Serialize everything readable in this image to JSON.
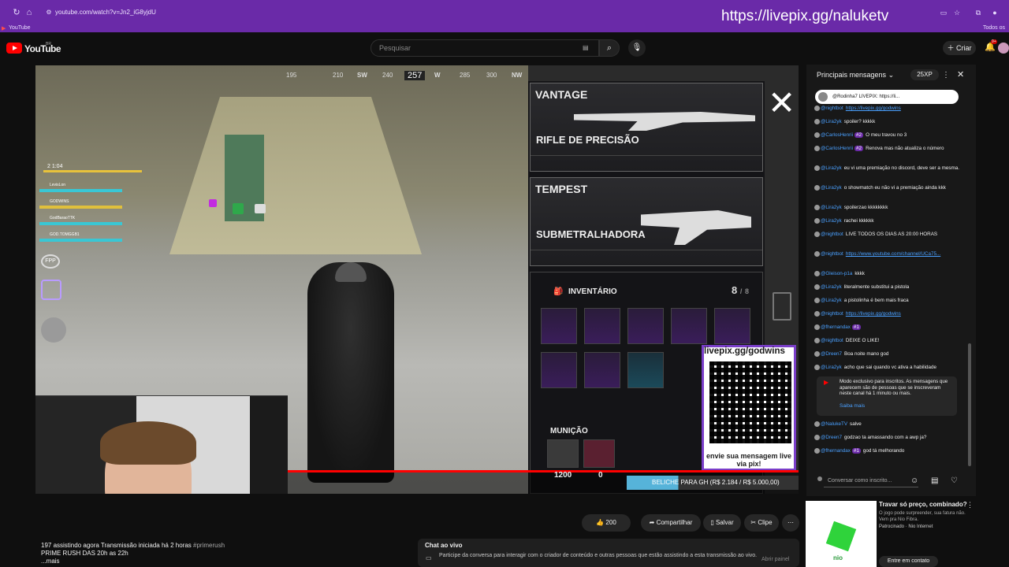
{
  "browser": {
    "url": "youtube.com/watch?v=Jn2_iG8yjdU",
    "bookmark_first": "YouTube",
    "bookmark_right": "Todos os",
    "overlay_banner": "https://livepix.gg/naluketv"
  },
  "header": {
    "logo_text": "YouTube",
    "region": "BR",
    "search_placeholder": "Pesquisar",
    "create_label": "Criar",
    "notification_count": "9+"
  },
  "video": {
    "compass": {
      "ticks": [
        "195",
        "210",
        "SW",
        "240",
        "257",
        "W",
        "285",
        "300",
        "NW"
      ],
      "current": "257"
    },
    "hud": {
      "round_info": "2 1:04",
      "team": [
        {
          "name": "LevisLon"
        },
        {
          "name": "GODWINS"
        },
        {
          "name": "GodBaraoTTK"
        },
        {
          "name": "GOD.TOMGGB1"
        }
      ],
      "fpp_label": "FPP"
    },
    "weapons": [
      {
        "name": "VANTAGE",
        "type": "RIFLE DE PRECISÃO"
      },
      {
        "name": "TEMPEST",
        "type": "SUBMETRALHADORA"
      }
    ],
    "inventory": {
      "title": "INVENTÁRIO",
      "count": "8",
      "capacity": "8",
      "ammo_title": "MUNIÇÃO"
    },
    "qr": {
      "label": "livepix.gg/godwins",
      "cta": "envie sua mensagem live via pix!"
    },
    "score": {
      "left": "1200",
      "right": "0"
    },
    "ticker_text": "BELICHE PARA GH (R$ 2.184 / R$ 5.000,00)"
  },
  "actions": {
    "likes": "200",
    "share": "Compartilhar",
    "save": "Salvar",
    "clip": "Clipe"
  },
  "description": {
    "line1": "197 assistindo agora  Transmissão iniciada há 2 horas",
    "hashtag": "#primerush",
    "line2": "PRIME RUSH DAS 20h as 22h",
    "more": "...mais"
  },
  "live_chat_box": {
    "title": "Chat ao vivo",
    "description": "Participe da conversa para interagir com o criador de conteúdo e outras pessoas que estão assistindo a esta transmissão ao vivo.",
    "open_button": "Abrir painel"
  },
  "chat": {
    "header": "Principais mensagens",
    "xp_badge": "25XP",
    "pinned": "@Rodinha7  LIVEPIX: https://li...",
    "messages": [
      {
        "user": "@nightbot",
        "text": "https://livepix.gg/godwins",
        "link": true
      },
      {
        "user": "@Lira2yk",
        "text": "spoiler? kkkkk"
      },
      {
        "user": "@CarlosHenrii",
        "badge": "#2",
        "text": "O meu travou no 3"
      },
      {
        "user": "@CarlosHenrii",
        "badge": "#2",
        "text": "Renova mas não atualiza o número"
      },
      {
        "user": "@Lira2yk",
        "text": "eu vi uma premiação no discord, deve ser a mesma."
      },
      {
        "user": "@Lira2yk",
        "text": "o showmatch eu não vi a premiação ainda kkk"
      },
      {
        "user": "@Lira2yk",
        "text": "spoilerzao kkkkkkkk"
      },
      {
        "user": "@Lira2yk",
        "text": "rachei kkkkkk"
      },
      {
        "user": "@nightbot",
        "text": "LIVE TODOS OS DIAS AS 20:00 HORAS"
      },
      {
        "user": "@nightbot",
        "text": "https://www.youtube.com/channel/UCa75...",
        "link": true
      },
      {
        "user": "@Gleison-p1a",
        "text": "kkkk"
      },
      {
        "user": "@Lira2yk",
        "text": "literalmente substitui a pistola"
      },
      {
        "user": "@Lira2yk",
        "text": "a pistolinha é bem mais fraca"
      },
      {
        "user": "@nightbot",
        "text": "https://livepix.gg/godwins",
        "link": true
      },
      {
        "user": "@fhernandax",
        "badge": "#1",
        "text": ""
      },
      {
        "user": "@nightbot",
        "text": "DEIXE O LIKE!"
      },
      {
        "user": "@Dreen7",
        "text": "Boa noite mano god"
      },
      {
        "user": "@Lira2yk",
        "text": "acho que sai quando vc ativa a habilidade"
      }
    ],
    "members_notice": "Modo exclusivo para inscritos. As mensagens que aparecem são de pessoas que se inscreveram neste canal há 1 minuto ou mais.",
    "members_link": "Saiba mais",
    "after_messages": [
      {
        "user": "@NalukeTV",
        "text": "salve"
      },
      {
        "user": "@Dreen7",
        "text": "godzao ta amassando com a awp ja?"
      },
      {
        "user": "@fhernandax",
        "badge": "#1",
        "text": "god tá melhorando"
      }
    ],
    "input_placeholder": "Conversar como inscrito..."
  },
  "ad": {
    "title": "Travar só preço, combinado?",
    "desc": "O jogo pode surpreender, sua fatura não. Vem pra Nio Fibra.",
    "sponsor": "Patrocinado · Nio Internet",
    "cta": "Entre em contato",
    "thumb_brand": "nio"
  },
  "colors": {
    "browser": "#6a2aa8",
    "accent_red": "#ff0000",
    "link_blue": "#4aa0ff",
    "purple_item": "#7a3ec9"
  }
}
